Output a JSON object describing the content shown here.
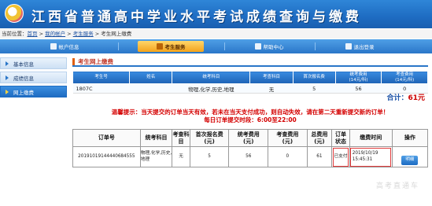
{
  "header": {
    "title": "江西省普通高中学业水平考试成绩查询与缴费"
  },
  "breadcrumb": {
    "prefix": "当前位置：",
    "home": "首页",
    "sep": " > ",
    "account": "我的帐户",
    "service": "考生服务",
    "current": "考生网上缴费"
  },
  "nav": {
    "items": [
      {
        "label": "帐户信息",
        "icon": "user-icon"
      },
      {
        "label": "考生服务",
        "icon": "service-icon"
      },
      {
        "label": "帮助中心",
        "icon": "help-icon"
      },
      {
        "label": "退出登录",
        "icon": "logout-icon"
      }
    ]
  },
  "sidebar": {
    "items": [
      {
        "label": "基本信息"
      },
      {
        "label": "成绩信息"
      },
      {
        "label": "网上缴费"
      }
    ]
  },
  "main": {
    "title": "考生网上缴费",
    "fee_table": {
      "headers": [
        "考生号",
        "姓名",
        "统考科目",
        "考查科目",
        "首次报名费",
        "统考费用\n(14元/科)",
        "考查费用\n(14元/科)"
      ],
      "row": [
        "1807C",
        "",
        "物理,化学,历史,地理",
        "无",
        "5",
        "56",
        "0"
      ]
    },
    "total_label": "合计：",
    "total_value": "61元",
    "notice_line1": "温馨提示：当天提交的订单当天有效，若未在当天支付成功，则自动失效，请在第二天重新提交新的订单！",
    "notice_line2": "每日订单提交时段：6:00至22:00",
    "order_table": {
      "headers": [
        "订单号",
        "统考科目",
        "考查科目",
        "首次报名费\n(元)",
        "统考费用\n(元)",
        "考查费用\n(元)",
        "总费用\n(元)",
        "订单\n状态",
        "缴费时间",
        "操作"
      ],
      "row": [
        "20191019144440684555",
        "物理,化学,历史,地理",
        "无",
        "5",
        "56",
        "0",
        "61",
        "已支付",
        "2019/10/19 15:45:31",
        "明细"
      ]
    }
  },
  "watermark": "高考直通车"
}
